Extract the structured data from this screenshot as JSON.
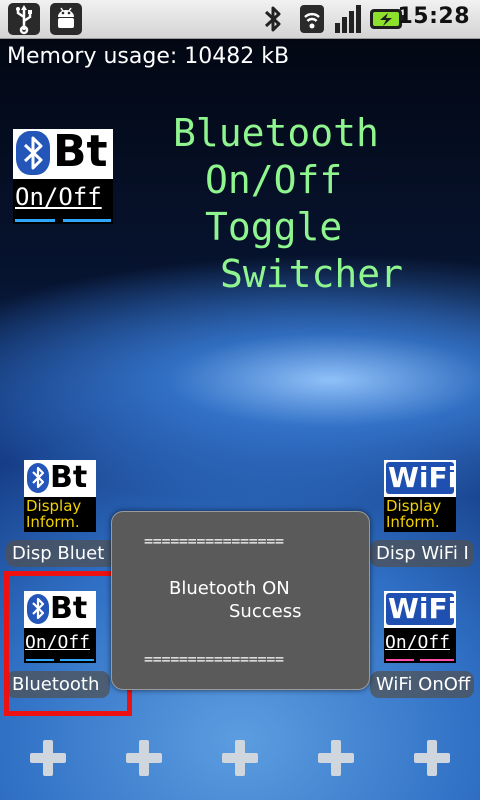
{
  "status_bar": {
    "time": "15:28"
  },
  "memory_text": "Memory usage: 10482 kB",
  "app_title": [
    "Bluetooth",
    "On/Off",
    "Toggle",
    "Switcher"
  ],
  "app_icon": {
    "logo_text": "Bt",
    "sub_text": "On/Off"
  },
  "shortcuts": {
    "disp_bluetooth": {
      "label": "Disp Bluet",
      "logo_text": "Bt",
      "sub_line1": "Display",
      "sub_line2": "Inform."
    },
    "bluetooth": {
      "label": "Bluetooth",
      "logo_text": "Bt",
      "sub_text": "On/Off"
    },
    "disp_wifi": {
      "label": "Disp WiFi I",
      "logo_text": "WiFi",
      "sub_line1": "Display",
      "sub_line2": "Inform."
    },
    "wifi": {
      "label": "WiFi OnOff",
      "logo_text": "WiFi",
      "sub_text": "On/Off"
    }
  },
  "toast": {
    "separator": "================",
    "line1": "Bluetooth ON",
    "line2": "Success"
  },
  "dock": {
    "add_buttons": 5
  },
  "colors": {
    "title": "#8ff58f",
    "highlight": "#ee1111",
    "bt_blue": "#2356b8",
    "wifi_blue": "#1f4fb0"
  }
}
